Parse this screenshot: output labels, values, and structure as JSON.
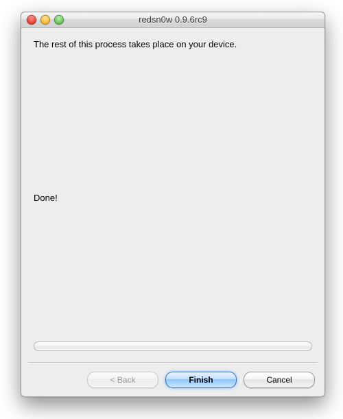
{
  "window": {
    "title": "redsn0w 0.9.6rc9"
  },
  "content": {
    "instruction": "The rest of this process takes place on your device.",
    "status": "Done!"
  },
  "progress": {
    "percent": 0
  },
  "buttons": {
    "back": "< Back",
    "finish": "Finish",
    "cancel": "Cancel"
  }
}
